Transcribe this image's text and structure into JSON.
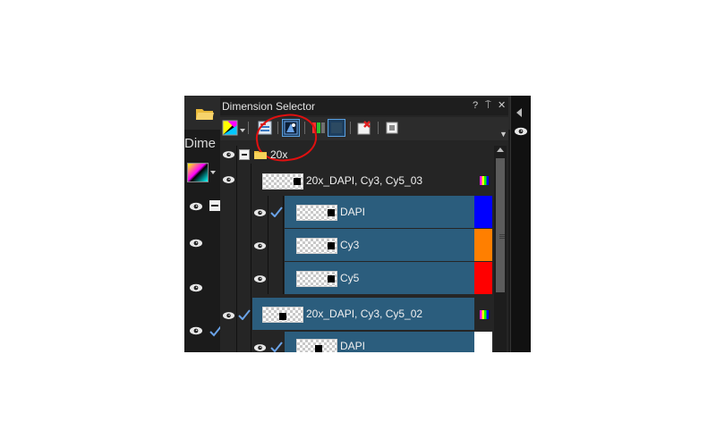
{
  "background_app": {
    "panel_label": "Dime"
  },
  "panel": {
    "title": "Dimension Selector",
    "buttons": {
      "help": "?",
      "pin": "⍑",
      "close": "✕"
    },
    "toolbar": [
      "color-mode",
      "dimension-list",
      "show-selected",
      "channels",
      "channel-view",
      "delete",
      "export"
    ],
    "highlight_color": "#e01010"
  },
  "tree": {
    "root": {
      "label": "20x"
    },
    "items": [
      {
        "label": "20x_DAPI, Cy3, Cy5_03",
        "type": "image"
      },
      {
        "label": "DAPI",
        "type": "channel",
        "color": "#0000ff",
        "checked": true
      },
      {
        "label": "Cy3",
        "type": "channel",
        "color": "#ff7f00",
        "checked": false
      },
      {
        "label": "Cy5",
        "type": "channel",
        "color": "#ff0000",
        "checked": false
      },
      {
        "label": "20x_DAPI, Cy3, Cy5_02",
        "type": "image",
        "checked": true
      },
      {
        "label": "DAPI",
        "type": "channel",
        "color": "#ffffff",
        "checked": true
      }
    ]
  },
  "colors": {
    "row_blue": "#2b5d7d",
    "panel_bg": "#252525"
  }
}
